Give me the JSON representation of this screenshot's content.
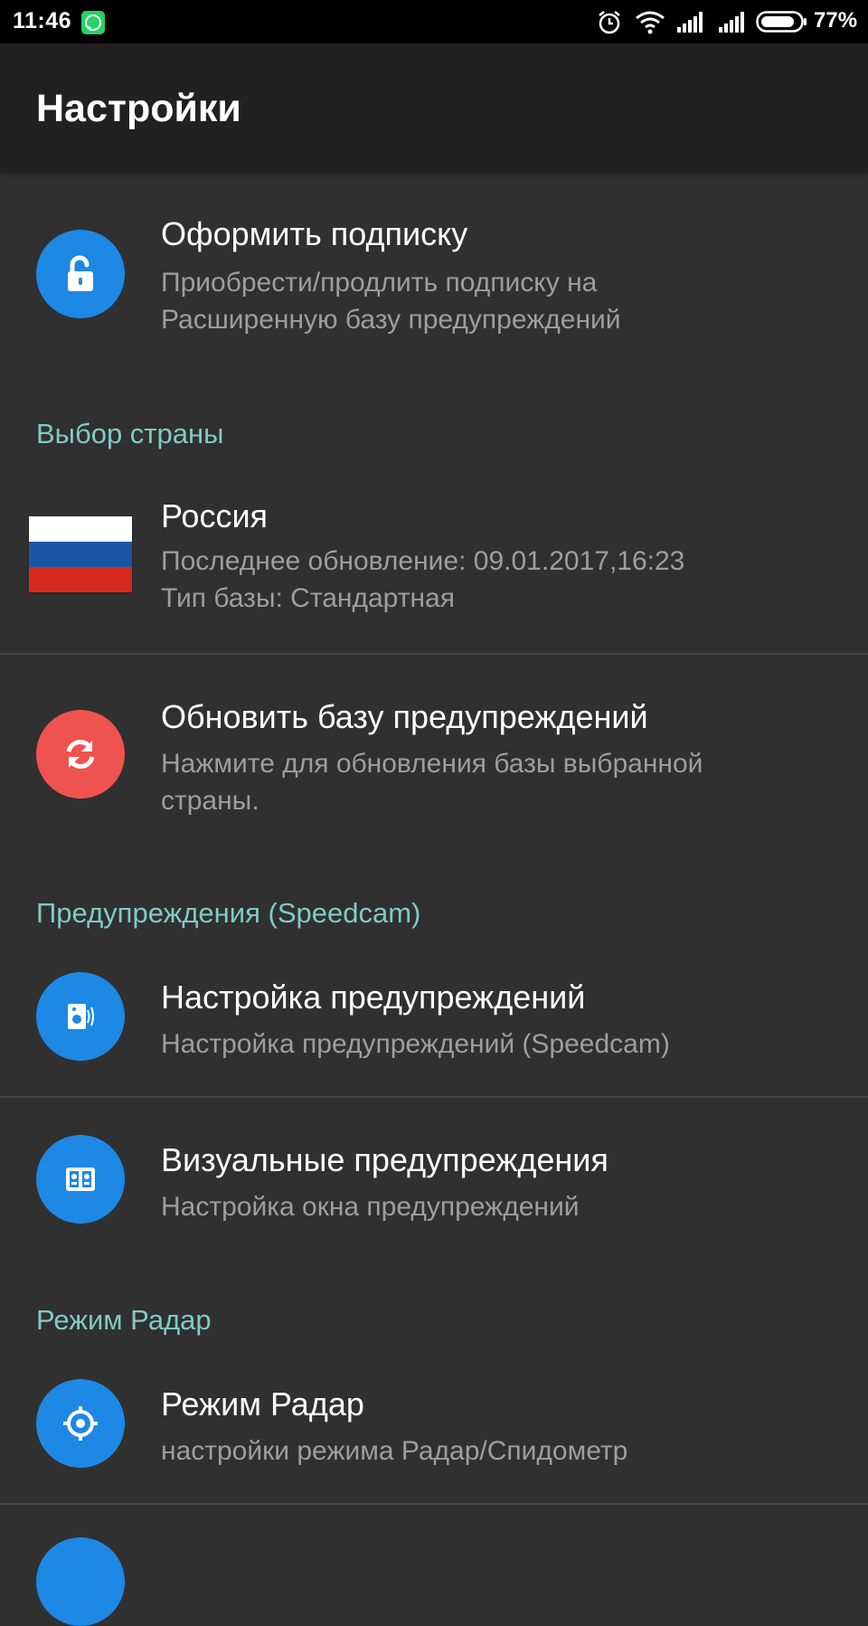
{
  "status_bar": {
    "time": "11:46",
    "battery_percent": "77%",
    "icons": [
      "whatsapp-icon",
      "alarm-icon",
      "wifi-icon",
      "signal-icon",
      "signal-icon",
      "battery-icon"
    ]
  },
  "app_bar": {
    "title": "Настройки"
  },
  "colors": {
    "accent_teal": "#80cbc4",
    "icon_blue": "#1e88e5",
    "icon_red": "#ef5350",
    "background": "#303030",
    "app_bar": "#212121"
  },
  "items": {
    "subscribe": {
      "title": "Оформить подписку",
      "subtitle_line1": "Приобрести/продлить подписку на",
      "subtitle_line2": "Расширенную базу предупреждений",
      "icon": "unlock-icon"
    },
    "country": {
      "title": "Россия",
      "subtitle_line1": "Последнее обновление: 09.01.2017,16:23",
      "subtitle_line2": "Тип базы: Стандартная",
      "icon": "russia-flag-icon"
    },
    "update_db": {
      "title": "Обновить базу предупреждений",
      "subtitle_line1": "Нажмите для обновления базы выбранной",
      "subtitle_line2": "страны.",
      "icon": "refresh-icon"
    },
    "warning_settings": {
      "title": "Настройка предупреждений",
      "subtitle_line1": "Настройка предупреждений (Speedcam)",
      "icon": "speedcam-icon"
    },
    "visual_warnings": {
      "title": "Визуальные предупреждения",
      "subtitle_line1": "Настройка окна предупреждений",
      "icon": "window-icon"
    },
    "radar_mode": {
      "title": "Режим Радар",
      "subtitle_line1": "настройки режима Радар/Спидометр",
      "icon": "crosshair-icon"
    }
  },
  "sections": {
    "country_header": "Выбор страны",
    "warnings_header": "Предупреждения (Speedcam)",
    "radar_header": "Режим Радар"
  }
}
